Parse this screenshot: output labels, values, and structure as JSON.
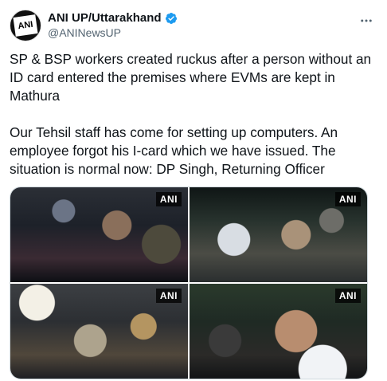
{
  "account": {
    "display_name": "ANI UP/Uttarakhand",
    "handle": "@ANINewsUP",
    "avatar_text": "ANI",
    "verified": true
  },
  "tweet": {
    "paragraphs": [
      "SP & BSP workers created ruckus after a person without an ID card entered the premises where EVMs are kept in Mathura",
      "Our Tehsil staff has come for setting up computers. An employee forgot his I-card which we have issued. The situation is normal now: DP Singh, Returning Officer"
    ]
  },
  "media": [
    {
      "watermark": "ANI"
    },
    {
      "watermark": "ANI"
    },
    {
      "watermark": "ANI"
    },
    {
      "watermark": "ANI"
    }
  ],
  "colors": {
    "text": "#0f1419",
    "secondary_text": "#536471",
    "verified_blue": "#1d9bf0",
    "border": "#cfd9de"
  },
  "icons": {
    "verified": "verified-badge-icon",
    "more": "more-horizontal-icon"
  }
}
